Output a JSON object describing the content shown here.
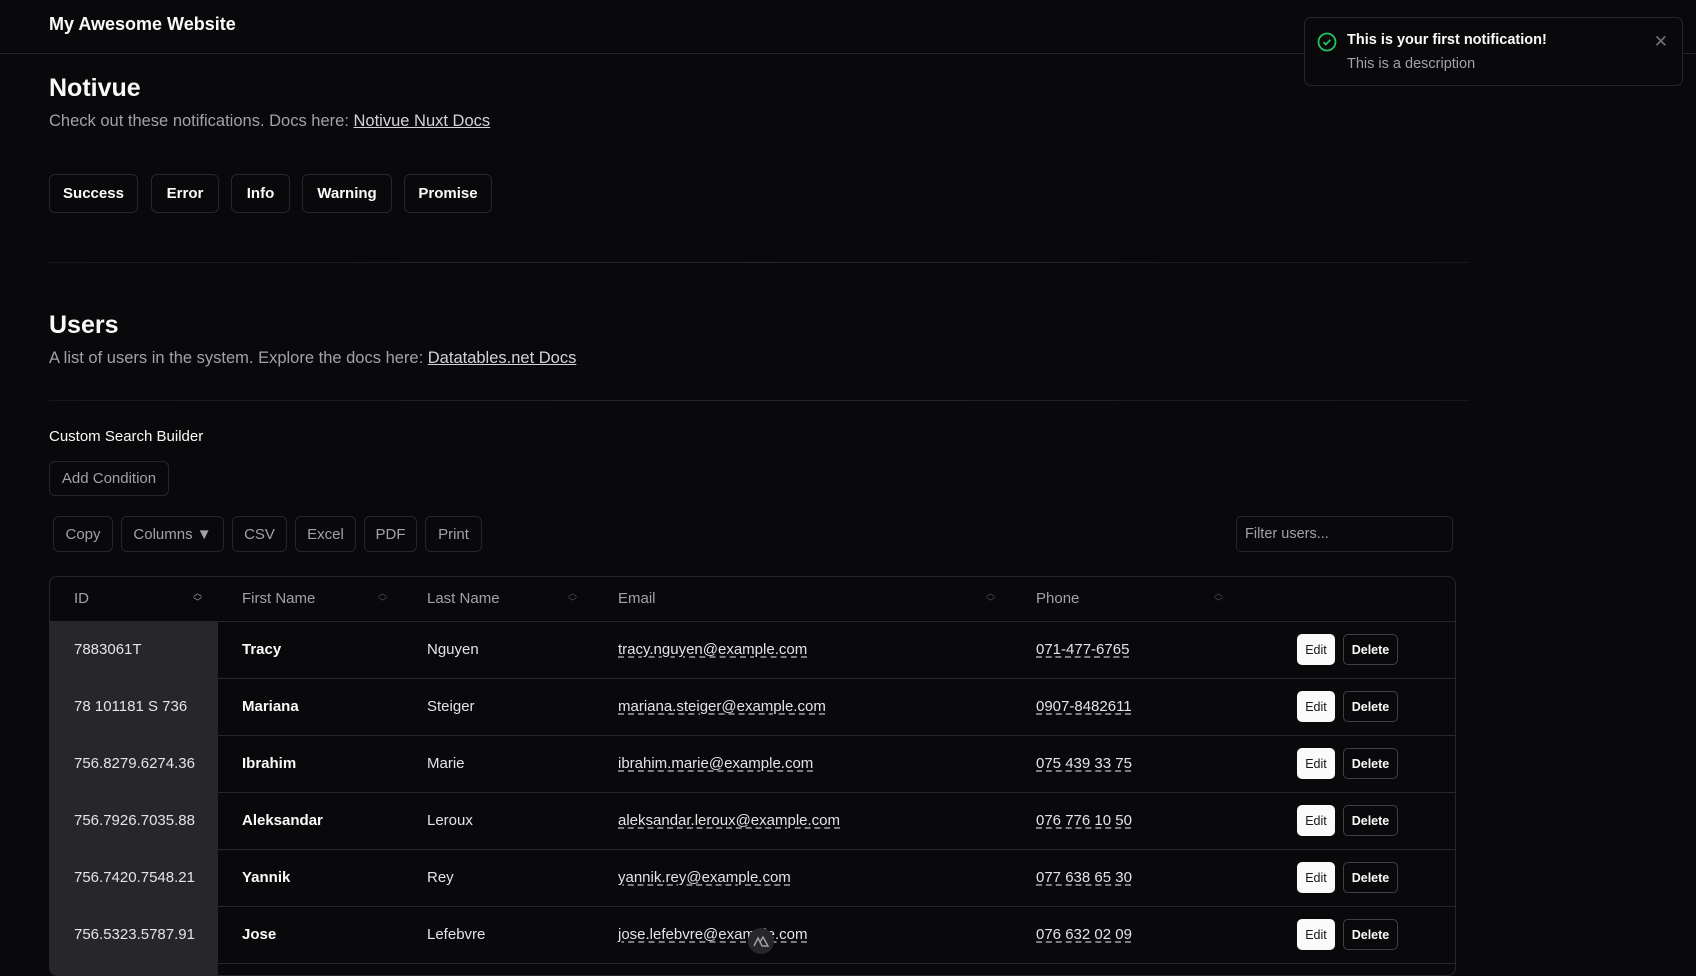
{
  "header": {
    "title": "My Awesome Website"
  },
  "notivue": {
    "title": "Notivue",
    "description": "Check out these notifications. Docs here: ",
    "docs_link": "Notivue Nuxt Docs",
    "buttons": [
      "Success",
      "Error",
      "Info",
      "Warning",
      "Promise"
    ]
  },
  "users": {
    "title": "Users",
    "description": "A list of users in the system. Explore the docs here: ",
    "docs_link": "Datatables.net Docs",
    "search_builder_label": "Custom Search Builder",
    "add_condition": "Add Condition",
    "toolbar": [
      "Copy",
      "Columns ▼",
      "CSV",
      "Excel",
      "PDF",
      "Print"
    ],
    "filter_placeholder": "Filter users...",
    "columns": [
      "ID",
      "First Name",
      "Last Name",
      "Email",
      "Phone"
    ],
    "edit_label": "Edit",
    "delete_label": "Delete",
    "rows": [
      {
        "id": "7883061T",
        "first": "Tracy",
        "last": "Nguyen",
        "email": "tracy.nguyen@example.com",
        "phone": "071-477-6765"
      },
      {
        "id": "78 101181 S 736",
        "first": "Mariana",
        "last": "Steiger",
        "email": "mariana.steiger@example.com",
        "phone": "0907-8482611"
      },
      {
        "id": "756.8279.6274.36",
        "first": "Ibrahim",
        "last": "Marie",
        "email": "ibrahim.marie@example.com",
        "phone": "075 439 33 75"
      },
      {
        "id": "756.7926.7035.88",
        "first": "Aleksandar",
        "last": "Leroux",
        "email": "aleksandar.leroux@example.com",
        "phone": "076 776 10 50"
      },
      {
        "id": "756.7420.7548.21",
        "first": "Yannik",
        "last": "Rey",
        "email": "yannik.rey@example.com",
        "phone": "077 638 65 30"
      },
      {
        "id": "756.5323.5787.91",
        "first": "Jose",
        "last": "Lefebvre",
        "email": "jose.lefebvre@example.com",
        "phone": "076 632 02 09"
      }
    ]
  },
  "notification": {
    "title": "This is your first notification!",
    "description": "This is a description",
    "icon": "check-circle-icon",
    "accent": "#22c55e"
  }
}
